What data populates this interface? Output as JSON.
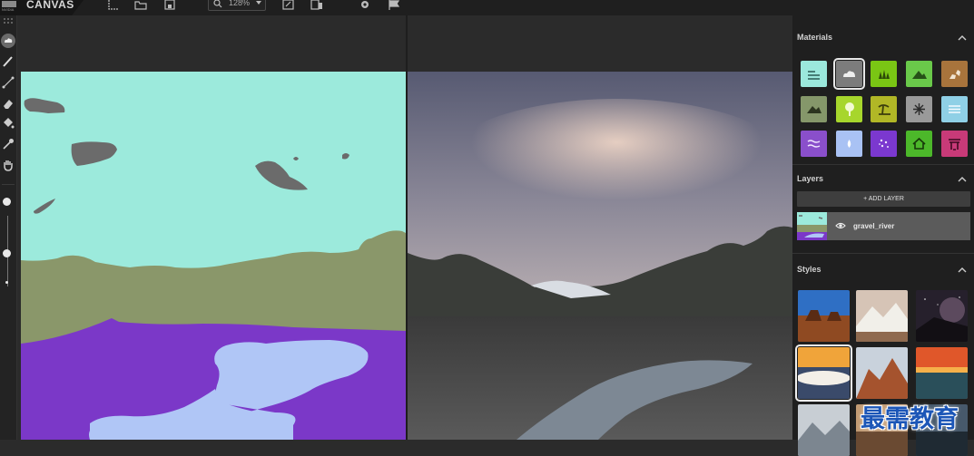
{
  "app": {
    "brand_name": "CANVAS"
  },
  "toolbar": {
    "zoom_value": "128%",
    "icons": [
      "select-icon",
      "open-icon",
      "save-icon",
      "zoom-icon",
      "expand-icon",
      "export-icon",
      "settings-icon",
      "flag-icon"
    ]
  },
  "tools": [
    "fill-cloud-tool",
    "brush-tool",
    "line-tool",
    "eraser-tool",
    "paint-bucket-tool",
    "eyedropper-tool",
    "pan-hand-tool"
  ],
  "brush_size_slider": {
    "max_label": "",
    "min_label": ""
  },
  "panel": {
    "materials": {
      "title": "Materials",
      "items": [
        {
          "name": "sea",
          "color": "#9be8dc",
          "icon": "sea-icon"
        },
        {
          "name": "cloud",
          "color": "#7c7c7c",
          "icon": "cloud-icon",
          "selected": true
        },
        {
          "name": "grass",
          "color": "#7ac614",
          "icon": "grass-icon"
        },
        {
          "name": "hill",
          "color": "#6ac94a",
          "icon": "hill-icon"
        },
        {
          "name": "rock",
          "color": "#a8743c",
          "icon": "rock-icon"
        },
        {
          "name": "mountain",
          "color": "#85976a",
          "icon": "mountain-icon"
        },
        {
          "name": "tree",
          "color": "#a7d62c",
          "icon": "tree-icon"
        },
        {
          "name": "palm",
          "color": "#b1b726",
          "icon": "palm-icon"
        },
        {
          "name": "snow",
          "color": "#9a9a9a",
          "icon": "snow-icon"
        },
        {
          "name": "water",
          "color": "#8fd0e6",
          "icon": "water-icon"
        },
        {
          "name": "river",
          "color": "#8a4fcb",
          "icon": "river-icon"
        },
        {
          "name": "fog",
          "color": "#a9c2f4",
          "icon": "fog-icon"
        },
        {
          "name": "flower",
          "color": "#7b38cf",
          "icon": "flower-icon"
        },
        {
          "name": "house",
          "color": "#4cb82a",
          "icon": "house-icon"
        },
        {
          "name": "bridge",
          "color": "#c83a78",
          "icon": "bridge-icon"
        }
      ]
    },
    "layers": {
      "title": "Layers",
      "add_label": "+ ADD LAYER",
      "items": [
        {
          "name": "gravel_river"
        }
      ]
    },
    "styles": {
      "title": "Styles",
      "thumbnails": [
        "desert-mesa",
        "snowy-peaks",
        "night-stars",
        "sunset-clouds",
        "red-canyon",
        "sunset-sea",
        "misty-mountains",
        "",
        ""
      ]
    }
  },
  "watermark": "最需教育",
  "colors": {
    "sky": "#9ceadc",
    "mountain": "#8a976a",
    "river": "#7b38c8",
    "fog": "#b0c6f6",
    "cloud": "#6b6b6b"
  }
}
